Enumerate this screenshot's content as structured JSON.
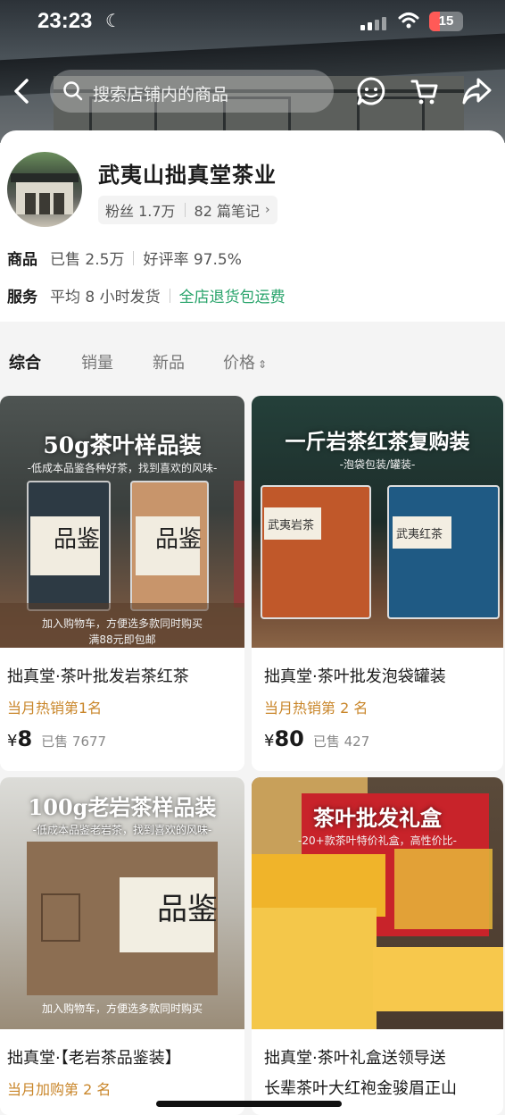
{
  "status_bar": {
    "time": "23:23",
    "battery": "15"
  },
  "nav": {
    "search_placeholder": "搜索店铺内的商品"
  },
  "shop": {
    "name": "武夷山拙真堂茶业",
    "followers": "粉丝 1.7万",
    "notes": "82 篇笔记",
    "goods_label": "商品",
    "sold": "已售 2.5万",
    "rating": "好评率 97.5%",
    "service_label": "服务",
    "shipping": "平均 8 小时发货",
    "return_policy": "全店退货包运费"
  },
  "tabs": [
    {
      "label": "综合",
      "active": true
    },
    {
      "label": "销量",
      "active": false
    },
    {
      "label": "新品",
      "active": false
    },
    {
      "label": "价格",
      "active": false
    }
  ],
  "products": [
    {
      "image_title": "50g茶叶样品装",
      "image_subtitle": "-低成本品鉴各种好茶，找到喜欢的风味-",
      "image_note_1": "加入购物车，方便选多款同时购买",
      "image_note_2": "满88元即包邮",
      "box_label": "品鉴",
      "title": "拙真堂·茶叶批发岩茶红茶",
      "rank": "当月热销第1名",
      "currency": "¥",
      "price": "8",
      "sold": "已售 7677"
    },
    {
      "image_title": "一斤岩茶红茶复购装",
      "image_subtitle": "-泡袋包装/罐装-",
      "box_label_left": "武夷岩茶",
      "box_label_right": "武夷红茶",
      "title": "拙真堂·茶叶批发泡袋罐装",
      "rank": "当月热销第 2 名",
      "currency": "¥",
      "price": "80",
      "sold": "已售 427"
    },
    {
      "image_title": "100g老岩茶样品装",
      "image_subtitle": "-低成本品鉴老岩茶，找到喜欢的风味-",
      "image_note_1": "加入购物车，方便选多款同时购买",
      "box_label": "品鉴",
      "title": "拙真堂·【老岩茶品鉴装】",
      "rank": "当月加购第 2 名"
    },
    {
      "image_title": "茶叶批发礼盒",
      "image_subtitle": "-20+款茶叶特价礼盒，高性价比-",
      "title_line1": "拙真堂·茶叶礼盒送领导送",
      "title_line2": "长辈茶叶大红袍金骏眉正山"
    }
  ],
  "colors": {
    "accent_green": "#27a36a",
    "rank_gold": "#c9862a"
  }
}
